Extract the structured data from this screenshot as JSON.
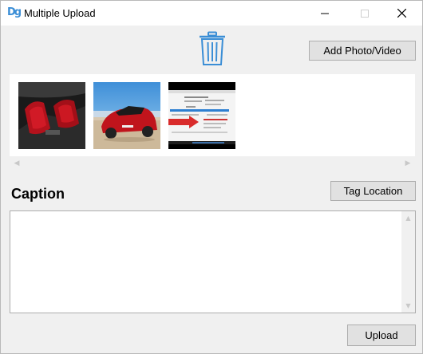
{
  "window": {
    "title": "Multiple Upload",
    "app_icon_text": "Dg",
    "controls": {
      "minimize": "minimize-icon",
      "maximize": "maximize-icon",
      "close": "close-icon"
    }
  },
  "toolbar": {
    "delete_icon": "trash-icon",
    "add_label": "Add Photo/Video"
  },
  "gallery": {
    "items": [
      {
        "name": "car-interior-red-seats"
      },
      {
        "name": "red-car-rear-view"
      },
      {
        "name": "screenshot-web-page"
      }
    ],
    "scroll_left_icon": "chevron-left-icon",
    "scroll_right_icon": "chevron-right-icon"
  },
  "caption": {
    "heading": "Caption",
    "value": "",
    "tag_location_label": "Tag Location"
  },
  "footer": {
    "upload_label": "Upload"
  },
  "colors": {
    "window_bg": "#f0f0f0",
    "button_bg": "#e1e1e1",
    "button_border": "#adadad",
    "trash_icon": "#3b8ed6"
  }
}
